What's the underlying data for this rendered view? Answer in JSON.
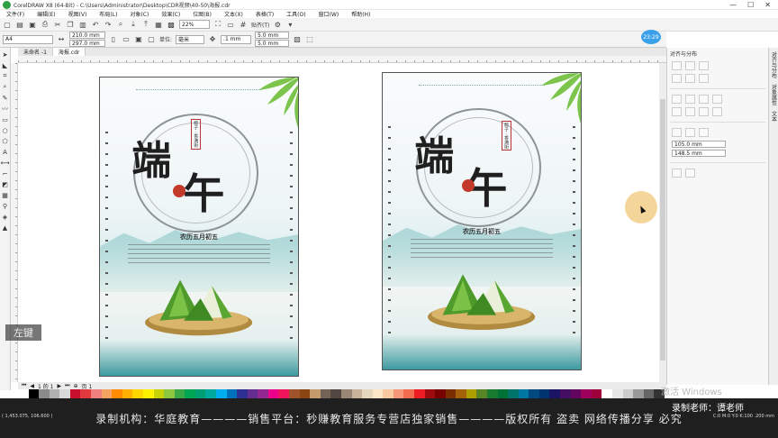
{
  "window": {
    "title": "CorelDRAW X8 (64-Bit) - C:\\Users\\Administrator\\Desktop\\CDR视频\\40-50\\海报.cdr",
    "minimize": "—",
    "maximize": "☐",
    "close": "✕"
  },
  "menu": [
    "文件(F)",
    "编辑(E)",
    "视图(V)",
    "布局(L)",
    "对象(C)",
    "效果(C)",
    "位图(B)",
    "文本(X)",
    "表格(T)",
    "工具(O)",
    "窗口(W)",
    "帮助(H)"
  ],
  "toolbar1": {
    "zoom": "22%",
    "snap_label": "贴齐(T)"
  },
  "toolbar2": {
    "paper_size": "A4",
    "width": "210.0 mm",
    "height": "297.0 mm",
    "units_label": "单位:",
    "units_value": "毫米",
    "nudge": ".1 mm",
    "dup_x": "5.0 mm",
    "dup_y": "5.0 mm"
  },
  "clock_badge": "23:29",
  "doc_tabs": [
    "未命名 -1",
    "海报.cdr"
  ],
  "right_panel": {
    "title": "对齐与分布",
    "x": "105.0 mm",
    "y": "148.5 mm",
    "side_tabs": [
      "对齐与分布",
      "对象属性",
      "文本"
    ]
  },
  "page_bar": {
    "current": "1 的 1",
    "page_label": "页 1"
  },
  "hint": "左键",
  "poster": {
    "char1": "端",
    "char2": "午",
    "subtitle": "农历五月初五",
    "vtext": "粽子 · 香满街"
  },
  "status": {
    "coords": "( 1,453.075, 106.600 )",
    "right": "C:0 M:0 Y:0 K:100 .200 mm"
  },
  "overlay": {
    "bottom_line": "录制机构：华庭教育————销售平台：秒赚教育服务专营店独家销售————版权所有 盗卖 网络传播分享 必究",
    "activate": "激活 Windows",
    "teacher": "录制老师：谭老师"
  },
  "palette": [
    "#ffffff",
    "#000000",
    "#8a8a8a",
    "#b0b0b0",
    "#d9d9d9",
    "#c8102e",
    "#e03a3e",
    "#f08080",
    "#f4a460",
    "#ff8c00",
    "#ffb000",
    "#ffd700",
    "#fff200",
    "#c7d30a",
    "#8dc63f",
    "#3aa845",
    "#00a651",
    "#009e73",
    "#00a99d",
    "#00aeef",
    "#0072bc",
    "#2e3192",
    "#662d91",
    "#92278f",
    "#ec008c",
    "#ed145b",
    "#a0522d",
    "#8b4513",
    "#c69c6d",
    "#736357",
    "#534741",
    "#998675",
    "#c7b299",
    "#e6d6bd",
    "#fbe6c8",
    "#f9c9a0",
    "#f7977a",
    "#f26c4f",
    "#ee1d24",
    "#9e0b0f",
    "#790000",
    "#7b2e00",
    "#a36209",
    "#aba000",
    "#598527",
    "#197b30",
    "#007236",
    "#00746b",
    "#0076a3",
    "#004a80",
    "#003471",
    "#1b1464",
    "#440e62",
    "#630460",
    "#9e005d",
    "#9e0039",
    "#ffffff",
    "#e6e6e6",
    "#cccccc",
    "#999999",
    "#666666",
    "#333333"
  ]
}
